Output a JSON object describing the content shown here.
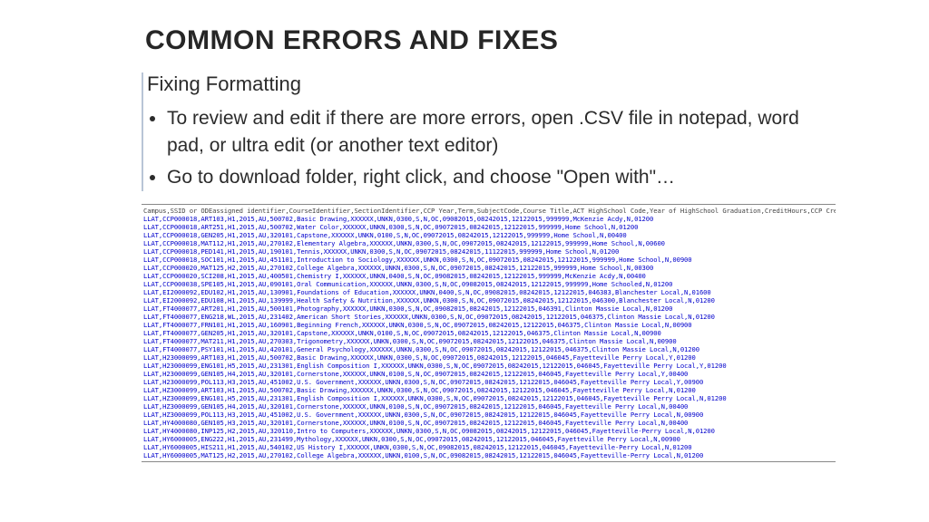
{
  "title": "COMMON ERRORS AND FIXES",
  "subtitle": "Fixing Formatting",
  "bullets": [
    "To review and edit if there are more errors, open .CSV file in notepad, word pad, or ultra edit (or another text editor)",
    "Go to download folder, right click, and choose \"Open with\"…"
  ],
  "csv_lines": [
    "Campus,SSID or ODEassigned identifier,CourseIdentifier,SectionIdentifier,CCP Year,Term,SubjectCode,Course Title,ACT HighSchool Code,Year of HighSchool Graduation,CreditHours,CCP Credit",
    "LLAT,CCP000018,ART103,H1,2015,AU,500702,Basic Drawing,XXXXXX,UNKN,0300,S,N,OC,09082015,08242015,12122015,999999,McKenzie Acdy,N,01200",
    "LLAT,CCP000018,ART251,H1,2015,AU,500702,Water Color,XXXXXX,UNKN,0300,S,N,OC,09072015,08242015,12122015,999999,Home School,N,01200",
    "LLAT,CCP000018,GEN205,H1,2015,AU,320101,Capstone,XXXXXX,UNKN,0100,S,N,OC,09072015,08242015,12122015,999999,Home School,N,00400",
    "LLAT,CCP000018,MAT112,H1,2015,AU,270102,Elementary Algebra,XXXXXX,UNKN,0300,S,N,OC,09072015,08242015,12122015,999999,Home School,N,00600",
    "LLAT,CCP000018,PED141,H1,2015,AU,190101,Tennis,XXXXXX,UNKN,0300,S,N,OC,09072015,08242015,11122015,999999,Home School,N,01200",
    "LLAT,CCP000018,SOC101,H1,2015,AU,451101,Introduction to Sociology,XXXXXX,UNKN,0300,S,N,OC,09072015,08242015,12122015,999999,Home School,N,00900",
    "LLAT,CCP000020,MAT125,H2,2015,AU,270102,College Algebra,XXXXXX,UNKN,0300,S,N,OC,09072015,08242015,12122015,999999,Home School,N,00300",
    "LLAT,CCP000020,SCI208,H1,2015,AU,400501,Chemistry I,XXXXXX,UNKN,0400,S,N,OC,09082015,08242015,12122015,999999,McKenzie Acdy,N,00400",
    "LLAT,CCP000038,SPE105,H1,2015,AU,090101,Oral Communication,XXXXXX,UNKN,0300,S,N,OC,09082015,08242015,12122015,999999,Home Schooled,N,01200",
    "LLAT,EI2000092,EDU102,H1,2015,AU,130901,Foundations of Education,XXXXXX,UNKN,0400,S,N,OC,09082015,08242015,12122015,046383,Blanchester Local,N,01600",
    "LLAT,EI2000092,EDU108,H1,2015,AU,139999,Health Safety & Nutrition,XXXXXX,UNKN,0300,S,N,OC,09072015,08242015,12122015,046300,Blanchester Local,N,01200",
    "LLAT,FT4000077,ART201,H1,2015,AU,500101,Photography,XXXXXX,UNKN,0300,S,N,OC,09082015,08242015,12122015,046391,Clinton Massie Local,N,01200",
    "LLAT,FT4000077,ENG218,WL,2015,AU,231402,American Short Stories,XXXXXX,UNKN,0300,S,N,OC,09072015,08242015,12122015,046375,Clinton Massie Local,N,01200",
    "LLAT,FT4000077,FRN101,H1,2015,AU,160901,Beginning French,XXXXXX,UNKN,0300,S,N,OC,09072015,08242015,12122015,046375,Clinton Massie Local,N,00900",
    "LLAT,FT4000077,GEN205,H1,2015,AU,320101,Capstone,XXXXXX,UNKN,0100,S,N,OC,09072015,08242015,12122015,046375,Clinton Massie Local,N,00900",
    "LLAT,FT4000077,MAT211,H1,2015,AU,270303,Trigonometry,XXXXXX,UNKN,0300,S,N,OC,09072015,08242015,12122015,046375,Clinton Massie Local,N,00900",
    "LLAT,FT4000077,PSY101,H1,2015,AU,420101,General Psychology,XXXXXX,UNKN,0300,S,N,OC,09072015,08242015,12122015,046375,Clinton Massie Local,N,01200",
    "LLAT,H23000099,ART103,H1,2015,AU,500702,Basic Drawing,XXXXXX,UNKN,0300,S,N,OC,09072015,08242015,12122015,046045,Fayetteville Perry Local,Y,01200",
    "LLAT,H23000099,ENG101,H5,2015,AU,231301,English Composition I,XXXXXX,UNKN,0300,S,N,OC,09072015,08242015,12122015,046045,Fayetteville Perry Local,Y,01200",
    "LLAT,H23000099,GEN105,H4,2015,AU,320101,Cornerstone,XXXXXX,UNKN,0100,S,N,OC,09072015,08242015,12122015,046045,Fayetteville Perry Local,Y,00400",
    "LLAT,H23000099,POL113,H3,2015,AU,451002,U.S. Government,XXXXXX,UNKN,0300,S,N,OC,09072015,08242015,12122015,046045,Fayetteville Perry Local,Y,00900",
    "LLAT,HZ3000099,ART103,H1,2015,AU,500702,Basic Drawing,XXXXXX,UNKN,0300,S,N,OC,09072015,08242015,12122015,046045,Fayetteville Perry Local,N,01200",
    "LLAT,HZ3000099,ENG101,H5,2015,AU,231301,English Composition I,XXXXXX,UNKN,0300,S,N,OC,09072015,08242015,12122015,046045,Fayetteville Perry Local,N,01200",
    "LLAT,HZ3000099,GEN105,H4,2015,AU,320101,Cornerstone,XXXXXX,UNKN,0100,S,N,OC,09072015,08242015,12122015,046045,Fayetteville Perry Local,N,00400",
    "LLAT,HZ3000099,POL113,H3,2015,AU,451002,U.S. Government,XXXXXX,UNKN,0300,S,N,OC,09072015,08242015,12122015,046045,Fayetteville Perry Local,N,00900",
    "LLAT,HY4000080,GEN105,H3,2015,AU,320101,Cornerstone,XXXXXX,UNKN,0100,S,N,OC,09072015,08242015,12122015,046045,Fayetteville Perry Local,N,00400",
    "LLAT,HY4000080,INP125,H2,2015,AU,320110,Intro  to Computers,XXXXXX,UNKN,0300,S,N,OC,09082015,08242015,12122015,046045,Fayetteville-Perry Local,N,01200",
    "LLAT,HY6000005,ENG222,H1,2015,AU,231499,Mythology,XXXXXX,UNKN,0300,S,N,OC,09072015,08242015,12122015,046045,Fayetteville Perry Local,N,00900",
    "LLAT,HY6000005,HIS211,H1,2015,AU,540102,US History I,XXXXXX,UNKN,0300,S,N,OC,09082015,08242015,12122015,046045,Fayetteville-Perry Local,N,01200",
    "LLAT,HY6000005,MAT125,H2,2015,AU,270102,College Algebra,XXXXXX,UNKN,0100,S,N,OC,09082015,08242015,12122015,046045,Fayetteville-Perry Local,N,01200"
  ]
}
